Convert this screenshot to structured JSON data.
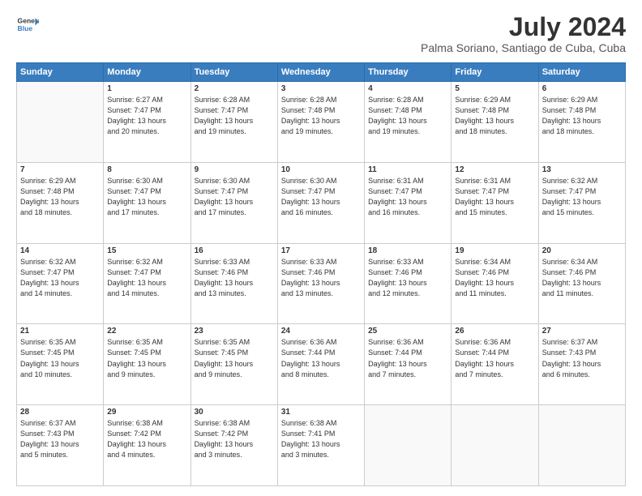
{
  "header": {
    "logo_line1": "General",
    "logo_line2": "Blue",
    "title": "July 2024",
    "subtitle": "Palma Soriano, Santiago de Cuba, Cuba"
  },
  "weekdays": [
    "Sunday",
    "Monday",
    "Tuesday",
    "Wednesday",
    "Thursday",
    "Friday",
    "Saturday"
  ],
  "weeks": [
    [
      {
        "day": "",
        "info": ""
      },
      {
        "day": "1",
        "info": "Sunrise: 6:27 AM\nSunset: 7:47 PM\nDaylight: 13 hours\nand 20 minutes."
      },
      {
        "day": "2",
        "info": "Sunrise: 6:28 AM\nSunset: 7:47 PM\nDaylight: 13 hours\nand 19 minutes."
      },
      {
        "day": "3",
        "info": "Sunrise: 6:28 AM\nSunset: 7:48 PM\nDaylight: 13 hours\nand 19 minutes."
      },
      {
        "day": "4",
        "info": "Sunrise: 6:28 AM\nSunset: 7:48 PM\nDaylight: 13 hours\nand 19 minutes."
      },
      {
        "day": "5",
        "info": "Sunrise: 6:29 AM\nSunset: 7:48 PM\nDaylight: 13 hours\nand 18 minutes."
      },
      {
        "day": "6",
        "info": "Sunrise: 6:29 AM\nSunset: 7:48 PM\nDaylight: 13 hours\nand 18 minutes."
      }
    ],
    [
      {
        "day": "7",
        "info": "Sunrise: 6:29 AM\nSunset: 7:48 PM\nDaylight: 13 hours\nand 18 minutes."
      },
      {
        "day": "8",
        "info": "Sunrise: 6:30 AM\nSunset: 7:47 PM\nDaylight: 13 hours\nand 17 minutes."
      },
      {
        "day": "9",
        "info": "Sunrise: 6:30 AM\nSunset: 7:47 PM\nDaylight: 13 hours\nand 17 minutes."
      },
      {
        "day": "10",
        "info": "Sunrise: 6:30 AM\nSunset: 7:47 PM\nDaylight: 13 hours\nand 16 minutes."
      },
      {
        "day": "11",
        "info": "Sunrise: 6:31 AM\nSunset: 7:47 PM\nDaylight: 13 hours\nand 16 minutes."
      },
      {
        "day": "12",
        "info": "Sunrise: 6:31 AM\nSunset: 7:47 PM\nDaylight: 13 hours\nand 15 minutes."
      },
      {
        "day": "13",
        "info": "Sunrise: 6:32 AM\nSunset: 7:47 PM\nDaylight: 13 hours\nand 15 minutes."
      }
    ],
    [
      {
        "day": "14",
        "info": "Sunrise: 6:32 AM\nSunset: 7:47 PM\nDaylight: 13 hours\nand 14 minutes."
      },
      {
        "day": "15",
        "info": "Sunrise: 6:32 AM\nSunset: 7:47 PM\nDaylight: 13 hours\nand 14 minutes."
      },
      {
        "day": "16",
        "info": "Sunrise: 6:33 AM\nSunset: 7:46 PM\nDaylight: 13 hours\nand 13 minutes."
      },
      {
        "day": "17",
        "info": "Sunrise: 6:33 AM\nSunset: 7:46 PM\nDaylight: 13 hours\nand 13 minutes."
      },
      {
        "day": "18",
        "info": "Sunrise: 6:33 AM\nSunset: 7:46 PM\nDaylight: 13 hours\nand 12 minutes."
      },
      {
        "day": "19",
        "info": "Sunrise: 6:34 AM\nSunset: 7:46 PM\nDaylight: 13 hours\nand 11 minutes."
      },
      {
        "day": "20",
        "info": "Sunrise: 6:34 AM\nSunset: 7:46 PM\nDaylight: 13 hours\nand 11 minutes."
      }
    ],
    [
      {
        "day": "21",
        "info": "Sunrise: 6:35 AM\nSunset: 7:45 PM\nDaylight: 13 hours\nand 10 minutes."
      },
      {
        "day": "22",
        "info": "Sunrise: 6:35 AM\nSunset: 7:45 PM\nDaylight: 13 hours\nand 9 minutes."
      },
      {
        "day": "23",
        "info": "Sunrise: 6:35 AM\nSunset: 7:45 PM\nDaylight: 13 hours\nand 9 minutes."
      },
      {
        "day": "24",
        "info": "Sunrise: 6:36 AM\nSunset: 7:44 PM\nDaylight: 13 hours\nand 8 minutes."
      },
      {
        "day": "25",
        "info": "Sunrise: 6:36 AM\nSunset: 7:44 PM\nDaylight: 13 hours\nand 7 minutes."
      },
      {
        "day": "26",
        "info": "Sunrise: 6:36 AM\nSunset: 7:44 PM\nDaylight: 13 hours\nand 7 minutes."
      },
      {
        "day": "27",
        "info": "Sunrise: 6:37 AM\nSunset: 7:43 PM\nDaylight: 13 hours\nand 6 minutes."
      }
    ],
    [
      {
        "day": "28",
        "info": "Sunrise: 6:37 AM\nSunset: 7:43 PM\nDaylight: 13 hours\nand 5 minutes."
      },
      {
        "day": "29",
        "info": "Sunrise: 6:38 AM\nSunset: 7:42 PM\nDaylight: 13 hours\nand 4 minutes."
      },
      {
        "day": "30",
        "info": "Sunrise: 6:38 AM\nSunset: 7:42 PM\nDaylight: 13 hours\nand 3 minutes."
      },
      {
        "day": "31",
        "info": "Sunrise: 6:38 AM\nSunset: 7:41 PM\nDaylight: 13 hours\nand 3 minutes."
      },
      {
        "day": "",
        "info": ""
      },
      {
        "day": "",
        "info": ""
      },
      {
        "day": "",
        "info": ""
      }
    ]
  ]
}
